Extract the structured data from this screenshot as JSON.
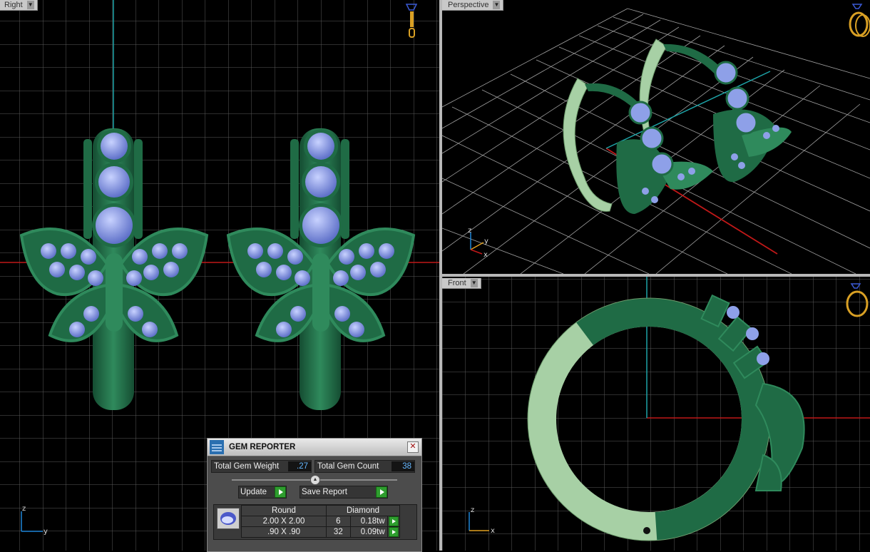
{
  "viewports": {
    "right": {
      "label": "Right"
    },
    "perspective": {
      "label": "Perspective"
    },
    "front": {
      "label": "Front"
    }
  },
  "axes": {
    "right": {
      "vertical": "z",
      "horizontal": "y"
    },
    "perspective": {
      "vertical": "z",
      "depth": "y",
      "horizontal": "x"
    },
    "front": {
      "vertical": "z",
      "horizontal": "x"
    }
  },
  "colors": {
    "metal_dark": "#1f6b45",
    "metal_light": "#a7d0a5",
    "gem": "#8ea0e8",
    "grid": "#5a5a5a",
    "x_axis": "#c01818",
    "y_axis": "#1da4a8"
  },
  "gem_reporter": {
    "title": "GEM REPORTER",
    "close_icon": "close-icon",
    "total_weight_label": "Total Gem Weight",
    "total_weight_value": ".27",
    "total_count_label": "Total Gem Count",
    "total_count_value": "38",
    "update_label": "Update",
    "save_report_label": "Save Report",
    "shape": "Round",
    "material": "Diamond",
    "rows": [
      {
        "size": "2.00 X 2.00",
        "count": "6",
        "weight": "0.18tw"
      },
      {
        "size": ".90 X .90",
        "count": "32",
        "weight": "0.09tw"
      }
    ]
  }
}
